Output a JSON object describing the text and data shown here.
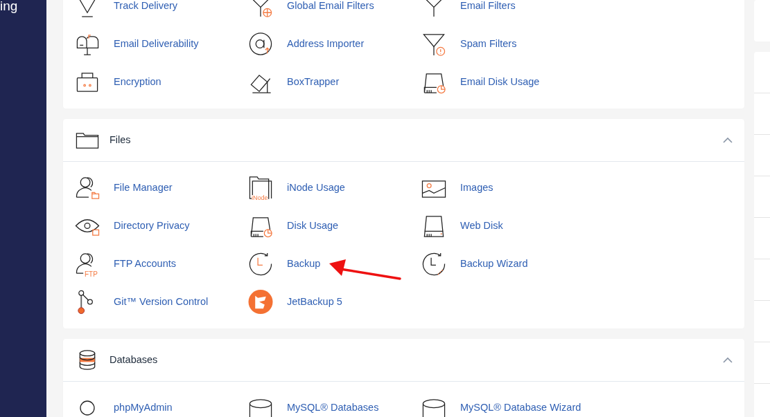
{
  "sidebar": {
    "label": "ing"
  },
  "sections": [
    {
      "items": [
        {
          "label": "Track Delivery"
        },
        {
          "label": "Global Email Filters"
        },
        {
          "label": "Email Filters"
        },
        {
          "label": "Email Deliverability"
        },
        {
          "label": "Address Importer"
        },
        {
          "label": "Spam Filters"
        },
        {
          "label": "Encryption"
        },
        {
          "label": "BoxTrapper"
        },
        {
          "label": "Email Disk Usage"
        }
      ]
    },
    {
      "title": "Files",
      "expanded": true,
      "items": [
        {
          "label": "File Manager"
        },
        {
          "label": "iNode Usage",
          "icon_text": "iNode"
        },
        {
          "label": "Images"
        },
        {
          "label": "Directory Privacy"
        },
        {
          "label": "Disk Usage"
        },
        {
          "label": "Web Disk"
        },
        {
          "label": "FTP Accounts",
          "icon_text": "FTP"
        },
        {
          "label": "Backup"
        },
        {
          "label": "Backup Wizard"
        },
        {
          "label": "Git™ Version Control"
        },
        {
          "label": "JetBackup 5"
        }
      ]
    },
    {
      "title": "Databases",
      "expanded": true,
      "items": [
        {
          "label": "phpMyAdmin"
        },
        {
          "label": "MySQL® Databases"
        },
        {
          "label": "MySQL® Database Wizard"
        }
      ]
    }
  ],
  "annotation_arrow": {
    "color": "#ee1111"
  }
}
